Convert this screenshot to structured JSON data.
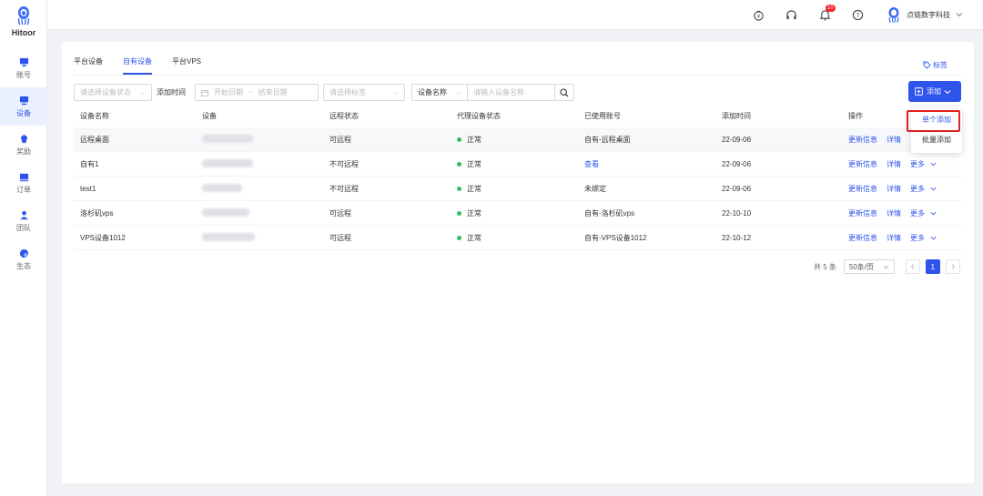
{
  "app": {
    "logo_text": "Hitoor"
  },
  "sidebar": {
    "items": [
      {
        "label": "账号",
        "icon": "monitor-icon"
      },
      {
        "label": "设备",
        "icon": "device-icon",
        "active": true
      },
      {
        "label": "奖励",
        "icon": "reward-icon"
      },
      {
        "label": "订单",
        "icon": "order-icon"
      },
      {
        "label": "团队",
        "icon": "team-icon"
      },
      {
        "label": "生态",
        "icon": "ecology-icon"
      }
    ]
  },
  "topbar": {
    "notification_count": "10",
    "user_name": "点链数字科技"
  },
  "tabs": [
    {
      "label": "平台设备"
    },
    {
      "label": "自有设备",
      "active": true
    },
    {
      "label": "平台VPS"
    }
  ],
  "tag_link": "标签",
  "filters": {
    "status_placeholder": "请选择设备状态",
    "date_label": "添加时间",
    "start_date": "开始日期",
    "date_sep": "~",
    "end_date": "结束日期",
    "tag_placeholder": "请选择标签",
    "field_select": "设备名称",
    "search_placeholder": "请输入设备名称"
  },
  "add_button": "添加",
  "dropdown": {
    "single": "单个添加",
    "batch": "批量添加"
  },
  "table": {
    "headers": [
      "设备名称",
      "设备",
      "远程状态",
      "代理设备状态",
      "已使用账号",
      "添加时间",
      "操作"
    ],
    "rows": [
      {
        "name": "远程桌面",
        "remote": "可远程",
        "proxy": "正常",
        "account": "自有-远程桌面",
        "account_link": false,
        "date": "22-09-06"
      },
      {
        "name": "自有1",
        "remote": "不可远程",
        "proxy": "正常",
        "account": "查看",
        "account_link": true,
        "date": "22-09-06"
      },
      {
        "name": "test1",
        "remote": "不可远程",
        "proxy": "正常",
        "account": "未绑定",
        "account_link": false,
        "date": "22-09-06"
      },
      {
        "name": "洛杉矶vps",
        "remote": "可远程",
        "proxy": "正常",
        "account": "自有-洛杉矶vps",
        "account_link": false,
        "date": "22-10-10"
      },
      {
        "name": "VPS设备1012",
        "remote": "可远程",
        "proxy": "正常",
        "account": "自有-VPS设备1012",
        "account_link": false,
        "date": "22-10-12"
      }
    ],
    "ops": {
      "update": "更新信息",
      "detail": "详情",
      "more": "更多"
    }
  },
  "pagination": {
    "total": "共 5 条",
    "page_size": "50条/页",
    "current": "1"
  },
  "colors": {
    "primary": "#2f54eb",
    "success": "#2fc25b",
    "highlight": "#e02020"
  }
}
